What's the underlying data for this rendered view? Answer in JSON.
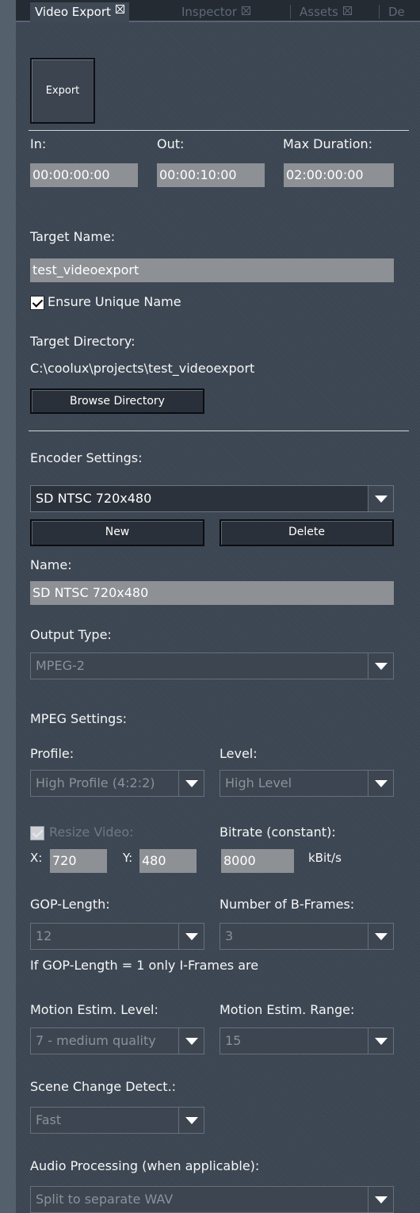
{
  "tabs": [
    {
      "label": "Video Export",
      "active": true
    },
    {
      "label": "Inspector",
      "active": false
    },
    {
      "label": "Assets",
      "active": false
    },
    {
      "label": "De",
      "active": false
    }
  ],
  "export_button": "Export",
  "in": {
    "label": "In:",
    "value": "00:00:00:00"
  },
  "out": {
    "label": "Out:",
    "value": "00:00:10:00"
  },
  "max_duration": {
    "label": "Max Duration:",
    "value": "02:00:00:00"
  },
  "target_name": {
    "label": "Target Name:",
    "value": "test_videoexport"
  },
  "ensure_unique": {
    "label": "Ensure Unique Name",
    "checked": true
  },
  "target_directory": {
    "label": "Target Directory:",
    "path": "C:\\coolux\\projects\\test_videoexport",
    "browse_label": "Browse Directory"
  },
  "encoder": {
    "label": "Encoder Settings:",
    "selected": "SD NTSC 720x480",
    "new_label": "New",
    "delete_label": "Delete"
  },
  "name": {
    "label": "Name:",
    "value": "SD NTSC 720x480"
  },
  "output_type": {
    "label": "Output Type:",
    "value": "MPEG-2"
  },
  "mpeg_settings_label": "MPEG Settings:",
  "profile": {
    "label": "Profile:",
    "value": "High Profile (4:2:2)"
  },
  "level": {
    "label": "Level:",
    "value": "High Level"
  },
  "resize": {
    "label": "Resize Video:",
    "checked": true,
    "enabled": false
  },
  "x": {
    "label": "X:",
    "value": "720"
  },
  "y": {
    "label": "Y:",
    "value": "480"
  },
  "bitrate": {
    "label": "Bitrate (constant):",
    "value": "8000",
    "unit": "kBit/s"
  },
  "gop_length": {
    "label": "GOP-Length:",
    "value": "12"
  },
  "b_frames": {
    "label": "Number of B-Frames:",
    "value": "3"
  },
  "gop_note": "If GOP-Length = 1 only I-Frames are",
  "motion_level": {
    "label": "Motion Estim. Level:",
    "value": "7 - medium quality"
  },
  "motion_range": {
    "label": "Motion Estim. Range:",
    "value": "15"
  },
  "scene_change": {
    "label": "Scene Change Detect.:",
    "value": "Fast"
  },
  "audio": {
    "label": "Audio Processing (when applicable):",
    "value": "Split to separate WAV"
  },
  "colors": {
    "background": "#3b4552",
    "field": "#8d9095",
    "tab_bar": "#242b33",
    "separator": "#cfd3d7"
  }
}
